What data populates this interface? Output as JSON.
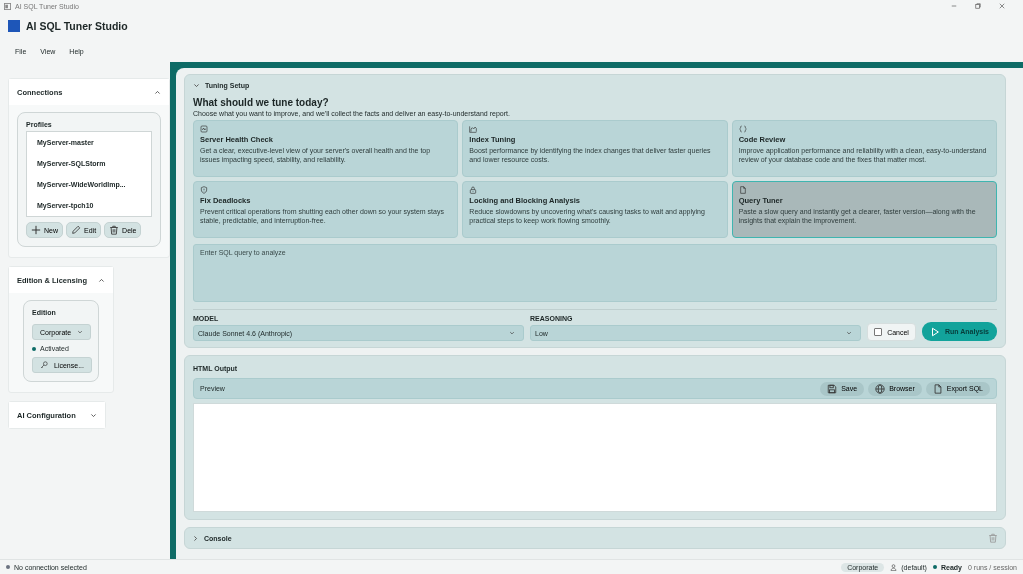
{
  "window": {
    "title": "AI SQL Tuner Studio",
    "app_title": "AI SQL Tuner Studio"
  },
  "menu": [
    "File",
    "View",
    "Help"
  ],
  "sidebar": {
    "connections": {
      "title": "Connections",
      "expanded": true,
      "profiles_label": "Profiles",
      "profiles": [
        {
          "name": "MyServer-master",
          "selected": false
        },
        {
          "name": "MyServer-SQLStorm",
          "selected": false
        },
        {
          "name": "MyServer-WideWorldImp...",
          "selected": false
        },
        {
          "name": "MyServer-tpch10",
          "selected": false
        }
      ],
      "buttons": [
        {
          "kind": "new",
          "label": "New"
        },
        {
          "kind": "edit",
          "label": "Edit"
        },
        {
          "kind": "delete",
          "label": "Dele"
        }
      ]
    },
    "edition": {
      "title": "Edition & Licensing",
      "expanded": true,
      "label": "Edition",
      "value": "Corporate",
      "status": "Activated",
      "license_button": "License..."
    },
    "ai_config": {
      "title": "AI Configuration",
      "expanded": false
    }
  },
  "tuning": {
    "title": "Tuning Setup",
    "expanded": true,
    "heading": "What should we tune today?",
    "subheading": "Choose what you want to improve, and we'll collect the facts and deliver an easy-to-understand report.",
    "cards": [
      {
        "kind": "health",
        "title": "Server Health Check",
        "description": "Get a clear, executive-level view of your server's overall health and the top issues impacting speed, stability, and reliability.",
        "selected": false
      },
      {
        "kind": "index",
        "title": "Index Tuning",
        "description": "Boost performance by identifying the index changes that deliver faster queries and lower resource costs.",
        "selected": false
      },
      {
        "kind": "code",
        "title": "Code Review",
        "description": "Improve application performance and reliability with a clean, easy-to-understand review of your database code and the fixes that matter most.",
        "selected": false
      },
      {
        "kind": "shield",
        "title": "Fix Deadlocks",
        "description": "Prevent critical operations from shutting each other down so your system stays stable, predictable, and interruption-free.",
        "selected": false
      },
      {
        "kind": "lock",
        "title": "Locking and Blocking Analysis",
        "description": "Reduce slowdowns by uncovering what's causing tasks to wait and applying practical steps to keep work flowing smoothly.",
        "selected": false
      },
      {
        "kind": "file",
        "title": "Query Tuner",
        "description": "Paste a slow query and instantly get a clearer, faster version—along with the insights that explain the improvement.",
        "selected": true
      }
    ],
    "query": {
      "placeholder": "Enter SQL query to analyze"
    },
    "model": {
      "label": "MODEL",
      "value": "Claude Sonnet 4.6 (Anthropic)"
    },
    "reasoning": {
      "label": "REASONING",
      "value": "Low"
    },
    "cancel": {
      "label": "Cancel",
      "checked": false
    },
    "run_button": "Run Analysis"
  },
  "output": {
    "title": "HTML Output",
    "preview_label": "Preview",
    "buttons": [
      {
        "kind": "save",
        "label": "Save"
      },
      {
        "kind": "browser",
        "label": "Browser"
      },
      {
        "kind": "export",
        "label": "Export SQL"
      }
    ]
  },
  "console": {
    "title": "Console",
    "expanded": false
  },
  "status_bar": {
    "connection": "No connection selected",
    "edition": "Corporate",
    "user": "(default)",
    "state": "Ready",
    "runs": "0 runs / session"
  }
}
